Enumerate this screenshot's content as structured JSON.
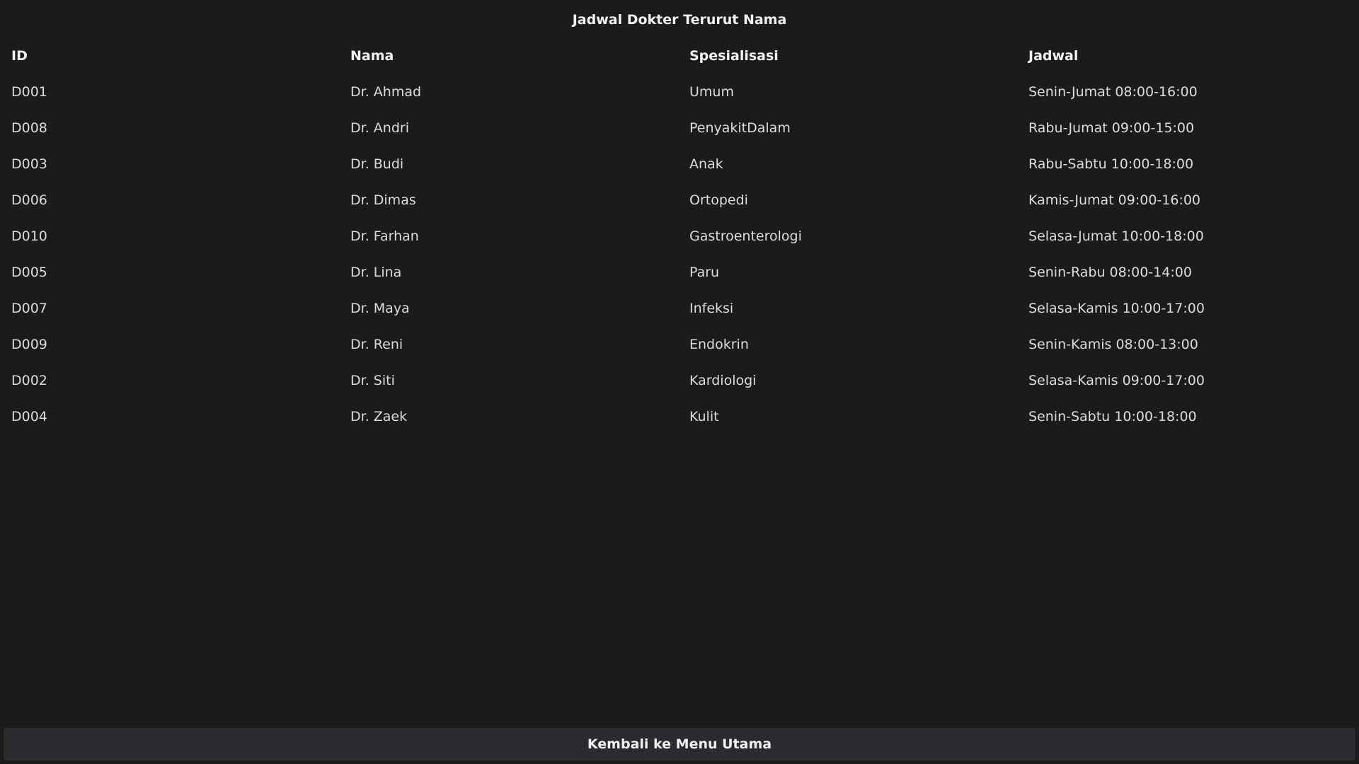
{
  "page": {
    "title": "Jadwal Dokter Terurut Nama"
  },
  "table": {
    "headers": [
      "ID",
      "Nama",
      "Spesialisasi",
      "Jadwal"
    ],
    "rows": [
      [
        "D001",
        "Dr. Ahmad",
        "Umum",
        "Senin-Jumat 08:00-16:00"
      ],
      [
        "D008",
        "Dr. Andri",
        "PenyakitDalam",
        "Rabu-Jumat 09:00-15:00"
      ],
      [
        "D003",
        "Dr. Budi",
        "Anak",
        "Rabu-Sabtu 10:00-18:00"
      ],
      [
        "D006",
        "Dr. Dimas",
        "Ortopedi",
        "Kamis-Jumat 09:00-16:00"
      ],
      [
        "D010",
        "Dr. Farhan",
        "Gastroenterologi",
        "Selasa-Jumat 10:00-18:00"
      ],
      [
        "D005",
        "Dr. Lina",
        "Paru",
        "Senin-Rabu 08:00-14:00"
      ],
      [
        "D007",
        "Dr. Maya",
        "Infeksi",
        "Selasa-Kamis 10:00-17:00"
      ],
      [
        "D009",
        "Dr. Reni",
        "Endokrin",
        "Senin-Kamis 08:00-13:00"
      ],
      [
        "D002",
        "Dr. Siti",
        "Kardiologi",
        "Selasa-Kamis 09:00-17:00"
      ],
      [
        "D004",
        "Dr. Zaek",
        "Kulit",
        "Senin-Sabtu 10:00-18:00"
      ]
    ]
  },
  "footer": {
    "back_button_label": "Kembali ke Menu Utama"
  }
}
